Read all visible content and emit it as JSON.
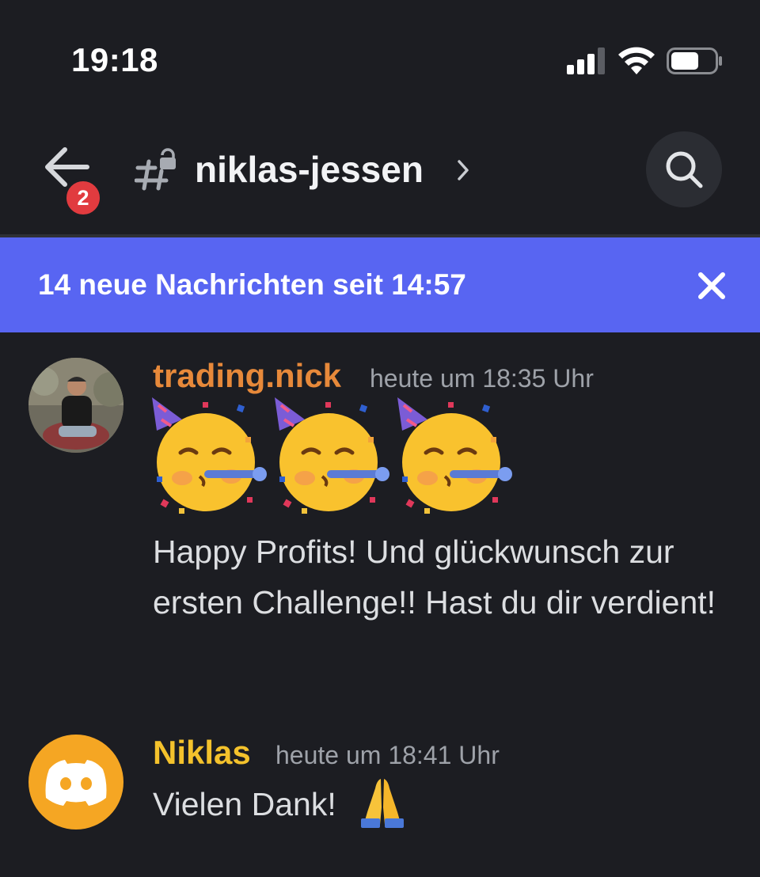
{
  "status_bar": {
    "time": "19:18"
  },
  "header": {
    "back_badge_count": "2",
    "channel_name": "niklas-jessen"
  },
  "banner": {
    "text": "14 neue Nachrichten seit 14:57"
  },
  "messages": [
    {
      "author": "trading.nick",
      "timestamp": "heute um 18:35 Uhr",
      "emojis": [
        "partying-face",
        "partying-face",
        "partying-face"
      ],
      "text": "Happy Profits! Und glückwunsch zur ersten Challenge!! Hast du dir verdient!",
      "author_color": "#e7893a"
    },
    {
      "author": "Niklas",
      "timestamp": "heute um 18:41 Uhr",
      "text": "Vielen Dank!",
      "trailing_emoji": "folded-hands",
      "author_color": "#f4c22c"
    }
  ],
  "colors": {
    "background": "#1c1d22",
    "banner": "#5865f2",
    "badge": "#e13b3f"
  }
}
